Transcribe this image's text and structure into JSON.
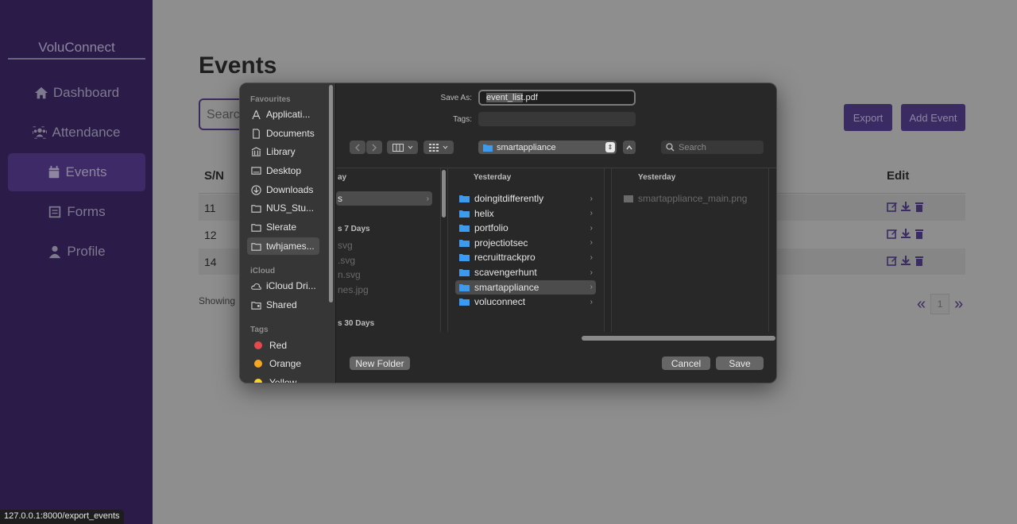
{
  "app": {
    "brand": "VoluConnect",
    "nav": [
      {
        "label": "Dashboard",
        "icon": "home-icon"
      },
      {
        "label": "Attendance",
        "icon": "people-icon"
      },
      {
        "label": "Events",
        "icon": "calendar-icon"
      },
      {
        "label": "Forms",
        "icon": "forms-icon"
      },
      {
        "label": "Profile",
        "icon": "user-icon"
      }
    ],
    "active_nav": "Events"
  },
  "page": {
    "title": "Events",
    "search_placeholder": "Search",
    "export_label": "Export",
    "add_event_label": "Add Event",
    "columns": {
      "sn": "S/N",
      "edit": "Edit"
    },
    "rows": [
      {
        "sn": "11"
      },
      {
        "sn": "12"
      },
      {
        "sn": "14"
      }
    ],
    "showing_text": "Showing",
    "pager": {
      "prev": "«",
      "page": "1",
      "next": "»"
    },
    "status_url": "127.0.0.1:8000/export_events"
  },
  "dialog": {
    "save_as_label": "Save As:",
    "save_as_value_sel": "event_list",
    "save_as_value_ext": ".pdf",
    "tags_label": "Tags:",
    "location": "smartappliance",
    "search_placeholder": "Search",
    "sidebar": {
      "favourites_header": "Favourites",
      "favourites": [
        "Applicati...",
        "Documents",
        "Library",
        "Desktop",
        "Downloads",
        "NUS_Stu...",
        "Slerate",
        "twhjames..."
      ],
      "selected_favourite": "twhjames...",
      "icloud_header": "iCloud",
      "icloud": [
        "iCloud Dri...",
        "Shared"
      ],
      "tags_header": "Tags",
      "tags": [
        {
          "label": "Red",
          "color": "#e5484d"
        },
        {
          "label": "Orange",
          "color": "#f5a623"
        },
        {
          "label": "Yellow",
          "color": "#f5d623"
        }
      ]
    },
    "col1": {
      "head": "ay",
      "selected_item": "s",
      "group1": "s 7 Days",
      "files": [
        "svg",
        ".svg",
        "n.svg",
        "nes.jpg"
      ],
      "group2": "s 30 Days"
    },
    "col2": {
      "head": "Yesterday",
      "folders": [
        "doingitdifferently",
        "helix",
        "portfolio",
        "projectiotsec",
        "recruittrackpro",
        "scavengerhunt",
        "smartappliance",
        "voluconnect"
      ],
      "selected": "smartappliance"
    },
    "col3": {
      "head": "Yesterday",
      "files": [
        "smartappliance_main.png"
      ]
    },
    "new_folder_label": "New Folder",
    "cancel_label": "Cancel",
    "save_label": "Save"
  }
}
